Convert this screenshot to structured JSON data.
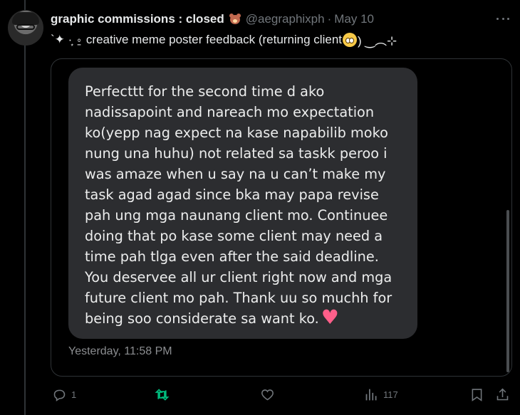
{
  "tweet": {
    "display_name": "graphic commissions : closed",
    "name_emoji": "teddy-bear",
    "handle": "@aegraphixph",
    "separator": "·",
    "date": "May 10",
    "text_prefix": "`✦ ·͙ ⍛ creative meme poster feedback (returning client",
    "text_suffix": ") ‿︵⊹"
  },
  "message": {
    "text": "Perfecttt for the second time d ako\nnadissapoint and nareach mo expectation\nko(yepp nag expect na kase napabilib moko\nnung una huhu) not related sa taskk peroo i\nwas amaze when u say na u can’t make my\ntask agad agad since bka may papa revise\npah ung mga naunang client mo. Continuee\ndoing that po kase some client may need a\ntime pah tlga even after the said deadline.\nYou deservee all ur client right now and mga\nfuture client mo pah. Thank uu so muchh for\nbeing soo considerate sa want ko.",
    "end_emoji": "pink-heart",
    "timestamp": "Yesterday, 11:58 PM"
  },
  "actions": {
    "reply_count": "1",
    "retweet_count": "",
    "like_count": "",
    "views_count": "117"
  },
  "colors": {
    "background": "#000000",
    "text": "#e7e9ea",
    "muted": "#71767b",
    "bubble": "#2c2d30",
    "retweet_accent": "#00ba7c",
    "border": "#2f3336"
  }
}
